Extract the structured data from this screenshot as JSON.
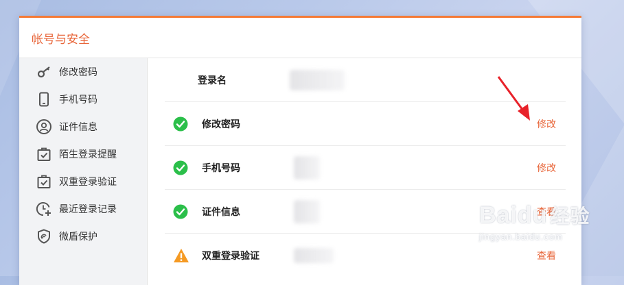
{
  "page": {
    "title": "帐号与安全"
  },
  "sidebar": {
    "items": [
      {
        "label": "修改密码",
        "icon": "key-icon"
      },
      {
        "label": "手机号码",
        "icon": "phone-icon"
      },
      {
        "label": "证件信息",
        "icon": "id-user-icon"
      },
      {
        "label": "陌生登录提醒",
        "icon": "bag-check-icon"
      },
      {
        "label": "双重登录验证",
        "icon": "bag-check-icon"
      },
      {
        "label": "最近登录记录",
        "icon": "clock-plus-icon"
      },
      {
        "label": "微盾保护",
        "icon": "shield-icon"
      }
    ]
  },
  "rows": [
    {
      "label": "登录名",
      "status": "none",
      "action": ""
    },
    {
      "label": "修改密码",
      "status": "ok",
      "action": "修改"
    },
    {
      "label": "手机号码",
      "status": "ok",
      "action": "修改"
    },
    {
      "label": "证件信息",
      "status": "ok",
      "action": "查看"
    },
    {
      "label": "双重登录验证",
      "status": "warning",
      "action": "查看"
    }
  ],
  "colors": {
    "accent": "#e8663a",
    "top_border": "#f57a35",
    "ok_green": "#2bbf4a",
    "warning_orange": "#f59a23",
    "arrow_red": "#e8222a"
  },
  "watermark": {
    "brand": "Baidu",
    "cn": "经验",
    "url": "jingyan.baidu.com"
  }
}
